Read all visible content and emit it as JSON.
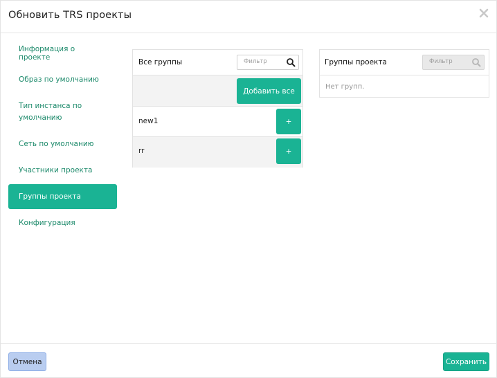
{
  "dialog": {
    "title": "Обновить TRS проекты"
  },
  "icons": {
    "close": "close-icon",
    "filter": "search-icon"
  },
  "colors": {
    "accent": "#1ab394",
    "nav_text": "#1d8a6b",
    "cancel_bg": "#b9cdf0"
  },
  "nav": {
    "items": [
      {
        "label": "Информация о проекте",
        "active": false
      },
      {
        "label": "Образ по умолчанию",
        "active": false
      },
      {
        "label": "Тип инстанса по умолчанию",
        "active": false
      },
      {
        "label": "Сеть по умолчанию",
        "active": false
      },
      {
        "label": "Участники проекта",
        "active": false
      },
      {
        "label": "Группы проекта",
        "active": true
      },
      {
        "label": "Конфигурация",
        "active": false
      }
    ]
  },
  "all_groups": {
    "title": "Все группы",
    "filter_placeholder": "Фильтр",
    "add_all_label": "Добавить все",
    "items": [
      {
        "name": "new1",
        "add_label": "+"
      },
      {
        "name": "rr",
        "add_label": "+"
      }
    ]
  },
  "project_groups": {
    "title": "Группы проекта",
    "filter_placeholder": "Фильтр",
    "empty_text": "Нет групп."
  },
  "footer": {
    "cancel_label": "Отмена",
    "save_label": "Сохранить"
  }
}
